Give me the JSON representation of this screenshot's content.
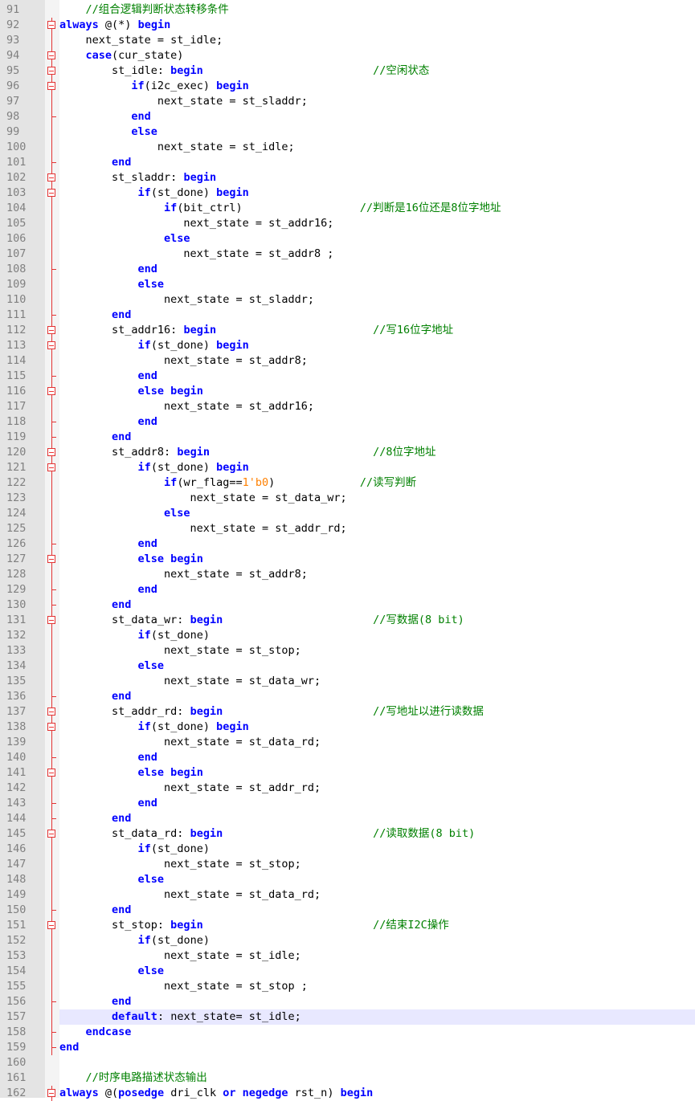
{
  "colors": {
    "keyword": "#0000ff",
    "comment": "#008000",
    "number": "#ff8000",
    "text": "#000000",
    "gutter": "#e4e4e4",
    "fold_marker": "#e33333",
    "current_line": "#e8e8ff"
  },
  "editor": {
    "current_line": 157,
    "lines": [
      {
        "n": "91",
        "fold": "none",
        "t": [
          [
            "c",
            "    //组合逻辑判断状态转移条件"
          ]
        ]
      },
      {
        "n": "92",
        "fold": "box",
        "t": [
          [
            "k",
            "always"
          ],
          [
            "p",
            " @(*) "
          ],
          [
            "k",
            "begin"
          ]
        ]
      },
      {
        "n": "93",
        "fold": "line",
        "t": [
          [
            "p",
            "    next_state = st_idle;"
          ]
        ]
      },
      {
        "n": "94",
        "fold": "box",
        "t": [
          [
            "p",
            "    "
          ],
          [
            "k",
            "case"
          ],
          [
            "p",
            "(cur_state)"
          ]
        ]
      },
      {
        "n": "95",
        "fold": "box",
        "t": [
          [
            "p",
            "        st_idle: "
          ],
          [
            "k",
            "begin"
          ],
          [
            "p",
            "                          "
          ],
          [
            "c",
            "//空闲状态"
          ]
        ]
      },
      {
        "n": "96",
        "fold": "box",
        "t": [
          [
            "p",
            "           "
          ],
          [
            "k",
            "if"
          ],
          [
            "p",
            "(i2c_exec) "
          ],
          [
            "k",
            "begin"
          ]
        ]
      },
      {
        "n": "97",
        "fold": "line",
        "t": [
          [
            "p",
            "               next_state = st_sladdr;"
          ]
        ]
      },
      {
        "n": "98",
        "fold": "tick",
        "t": [
          [
            "p",
            "           "
          ],
          [
            "k",
            "end"
          ]
        ]
      },
      {
        "n": "99",
        "fold": "line",
        "t": [
          [
            "p",
            "           "
          ],
          [
            "k",
            "else"
          ]
        ]
      },
      {
        "n": "100",
        "fold": "line",
        "t": [
          [
            "p",
            "               next_state = st_idle;"
          ]
        ]
      },
      {
        "n": "101",
        "fold": "tick",
        "t": [
          [
            "p",
            "        "
          ],
          [
            "k",
            "end"
          ]
        ]
      },
      {
        "n": "102",
        "fold": "box",
        "t": [
          [
            "p",
            "        st_sladdr: "
          ],
          [
            "k",
            "begin"
          ]
        ]
      },
      {
        "n": "103",
        "fold": "box",
        "t": [
          [
            "p",
            "            "
          ],
          [
            "k",
            "if"
          ],
          [
            "p",
            "(st_done) "
          ],
          [
            "k",
            "begin"
          ]
        ]
      },
      {
        "n": "104",
        "fold": "line",
        "t": [
          [
            "p",
            "                "
          ],
          [
            "k",
            "if"
          ],
          [
            "p",
            "(bit_ctrl)                  "
          ],
          [
            "c",
            "//判断是16位还是8位字地址"
          ]
        ]
      },
      {
        "n": "105",
        "fold": "line",
        "t": [
          [
            "p",
            "                   next_state = st_addr16;"
          ]
        ]
      },
      {
        "n": "106",
        "fold": "line",
        "t": [
          [
            "p",
            "                "
          ],
          [
            "k",
            "else"
          ]
        ]
      },
      {
        "n": "107",
        "fold": "line",
        "t": [
          [
            "p",
            "                   next_state = st_addr8 ;"
          ]
        ]
      },
      {
        "n": "108",
        "fold": "tick",
        "t": [
          [
            "p",
            "            "
          ],
          [
            "k",
            "end"
          ]
        ]
      },
      {
        "n": "109",
        "fold": "line",
        "t": [
          [
            "p",
            "            "
          ],
          [
            "k",
            "else"
          ]
        ]
      },
      {
        "n": "110",
        "fold": "line",
        "t": [
          [
            "p",
            "                next_state = st_sladdr;"
          ]
        ]
      },
      {
        "n": "111",
        "fold": "tick",
        "t": [
          [
            "p",
            "        "
          ],
          [
            "k",
            "end"
          ]
        ]
      },
      {
        "n": "112",
        "fold": "box",
        "t": [
          [
            "p",
            "        st_addr16: "
          ],
          [
            "k",
            "begin"
          ],
          [
            "p",
            "                        "
          ],
          [
            "c",
            "//写16位字地址"
          ]
        ]
      },
      {
        "n": "113",
        "fold": "box",
        "t": [
          [
            "p",
            "            "
          ],
          [
            "k",
            "if"
          ],
          [
            "p",
            "(st_done) "
          ],
          [
            "k",
            "begin"
          ]
        ]
      },
      {
        "n": "114",
        "fold": "line",
        "t": [
          [
            "p",
            "                next_state = st_addr8;"
          ]
        ]
      },
      {
        "n": "115",
        "fold": "tick",
        "t": [
          [
            "p",
            "            "
          ],
          [
            "k",
            "end"
          ]
        ]
      },
      {
        "n": "116",
        "fold": "box",
        "t": [
          [
            "p",
            "            "
          ],
          [
            "k",
            "else begin"
          ]
        ]
      },
      {
        "n": "117",
        "fold": "line",
        "t": [
          [
            "p",
            "                next_state = st_addr16;"
          ]
        ]
      },
      {
        "n": "118",
        "fold": "tick",
        "t": [
          [
            "p",
            "            "
          ],
          [
            "k",
            "end"
          ]
        ]
      },
      {
        "n": "119",
        "fold": "tick",
        "t": [
          [
            "p",
            "        "
          ],
          [
            "k",
            "end"
          ]
        ]
      },
      {
        "n": "120",
        "fold": "box",
        "t": [
          [
            "p",
            "        st_addr8: "
          ],
          [
            "k",
            "begin"
          ],
          [
            "p",
            "                         "
          ],
          [
            "c",
            "//8位字地址"
          ]
        ]
      },
      {
        "n": "121",
        "fold": "box",
        "t": [
          [
            "p",
            "            "
          ],
          [
            "k",
            "if"
          ],
          [
            "p",
            "(st_done) "
          ],
          [
            "k",
            "begin"
          ]
        ]
      },
      {
        "n": "122",
        "fold": "line",
        "t": [
          [
            "p",
            "                "
          ],
          [
            "k",
            "if"
          ],
          [
            "p",
            "(wr_flag=="
          ],
          [
            "n",
            "1'b0"
          ],
          [
            "p",
            ")             "
          ],
          [
            "c",
            "//读写判断"
          ]
        ]
      },
      {
        "n": "123",
        "fold": "line",
        "t": [
          [
            "p",
            "                    next_state = st_data_wr;"
          ]
        ]
      },
      {
        "n": "124",
        "fold": "line",
        "t": [
          [
            "p",
            "                "
          ],
          [
            "k",
            "else"
          ]
        ]
      },
      {
        "n": "125",
        "fold": "line",
        "t": [
          [
            "p",
            "                    next_state = st_addr_rd;"
          ]
        ]
      },
      {
        "n": "126",
        "fold": "tick",
        "t": [
          [
            "p",
            "            "
          ],
          [
            "k",
            "end"
          ]
        ]
      },
      {
        "n": "127",
        "fold": "box",
        "t": [
          [
            "p",
            "            "
          ],
          [
            "k",
            "else begin"
          ]
        ]
      },
      {
        "n": "128",
        "fold": "line",
        "t": [
          [
            "p",
            "                next_state = st_addr8;"
          ]
        ]
      },
      {
        "n": "129",
        "fold": "tick",
        "t": [
          [
            "p",
            "            "
          ],
          [
            "k",
            "end"
          ]
        ]
      },
      {
        "n": "130",
        "fold": "tick",
        "t": [
          [
            "p",
            "        "
          ],
          [
            "k",
            "end"
          ]
        ]
      },
      {
        "n": "131",
        "fold": "box",
        "t": [
          [
            "p",
            "        st_data_wr: "
          ],
          [
            "k",
            "begin"
          ],
          [
            "p",
            "                       "
          ],
          [
            "c",
            "//写数据(8 bit)"
          ]
        ]
      },
      {
        "n": "132",
        "fold": "line",
        "t": [
          [
            "p",
            "            "
          ],
          [
            "k",
            "if"
          ],
          [
            "p",
            "(st_done)"
          ]
        ]
      },
      {
        "n": "133",
        "fold": "line",
        "t": [
          [
            "p",
            "                next_state = st_stop;"
          ]
        ]
      },
      {
        "n": "134",
        "fold": "line",
        "t": [
          [
            "p",
            "            "
          ],
          [
            "k",
            "else"
          ]
        ]
      },
      {
        "n": "135",
        "fold": "line",
        "t": [
          [
            "p",
            "                next_state = st_data_wr;"
          ]
        ]
      },
      {
        "n": "136",
        "fold": "tick",
        "t": [
          [
            "p",
            "        "
          ],
          [
            "k",
            "end"
          ]
        ]
      },
      {
        "n": "137",
        "fold": "box",
        "t": [
          [
            "p",
            "        st_addr_rd: "
          ],
          [
            "k",
            "begin"
          ],
          [
            "p",
            "                       "
          ],
          [
            "c",
            "//写地址以进行读数据"
          ]
        ]
      },
      {
        "n": "138",
        "fold": "box",
        "t": [
          [
            "p",
            "            "
          ],
          [
            "k",
            "if"
          ],
          [
            "p",
            "(st_done) "
          ],
          [
            "k",
            "begin"
          ]
        ]
      },
      {
        "n": "139",
        "fold": "line",
        "t": [
          [
            "p",
            "                next_state = st_data_rd;"
          ]
        ]
      },
      {
        "n": "140",
        "fold": "tick",
        "t": [
          [
            "p",
            "            "
          ],
          [
            "k",
            "end"
          ]
        ]
      },
      {
        "n": "141",
        "fold": "box",
        "t": [
          [
            "p",
            "            "
          ],
          [
            "k",
            "else begin"
          ]
        ]
      },
      {
        "n": "142",
        "fold": "line",
        "t": [
          [
            "p",
            "                next_state = st_addr_rd;"
          ]
        ]
      },
      {
        "n": "143",
        "fold": "tick",
        "t": [
          [
            "p",
            "            "
          ],
          [
            "k",
            "end"
          ]
        ]
      },
      {
        "n": "144",
        "fold": "tick",
        "t": [
          [
            "p",
            "        "
          ],
          [
            "k",
            "end"
          ]
        ]
      },
      {
        "n": "145",
        "fold": "box",
        "t": [
          [
            "p",
            "        st_data_rd: "
          ],
          [
            "k",
            "begin"
          ],
          [
            "p",
            "                       "
          ],
          [
            "c",
            "//读取数据(8 bit)"
          ]
        ]
      },
      {
        "n": "146",
        "fold": "line",
        "t": [
          [
            "p",
            "            "
          ],
          [
            "k",
            "if"
          ],
          [
            "p",
            "(st_done)"
          ]
        ]
      },
      {
        "n": "147",
        "fold": "line",
        "t": [
          [
            "p",
            "                next_state = st_stop;"
          ]
        ]
      },
      {
        "n": "148",
        "fold": "line",
        "t": [
          [
            "p",
            "            "
          ],
          [
            "k",
            "else"
          ]
        ]
      },
      {
        "n": "149",
        "fold": "line",
        "t": [
          [
            "p",
            "                next_state = st_data_rd;"
          ]
        ]
      },
      {
        "n": "150",
        "fold": "tick",
        "t": [
          [
            "p",
            "        "
          ],
          [
            "k",
            "end"
          ]
        ]
      },
      {
        "n": "151",
        "fold": "box",
        "t": [
          [
            "p",
            "        st_stop: "
          ],
          [
            "k",
            "begin"
          ],
          [
            "p",
            "                          "
          ],
          [
            "c",
            "//结束I2C操作"
          ]
        ]
      },
      {
        "n": "152",
        "fold": "line",
        "t": [
          [
            "p",
            "            "
          ],
          [
            "k",
            "if"
          ],
          [
            "p",
            "(st_done)"
          ]
        ]
      },
      {
        "n": "153",
        "fold": "line",
        "t": [
          [
            "p",
            "                next_state = st_idle;"
          ]
        ]
      },
      {
        "n": "154",
        "fold": "line",
        "t": [
          [
            "p",
            "            "
          ],
          [
            "k",
            "else"
          ]
        ]
      },
      {
        "n": "155",
        "fold": "line",
        "t": [
          [
            "p",
            "                next_state = st_stop ;"
          ]
        ]
      },
      {
        "n": "156",
        "fold": "tick",
        "t": [
          [
            "p",
            "        "
          ],
          [
            "k",
            "end"
          ]
        ]
      },
      {
        "n": "157",
        "fold": "line",
        "t": [
          [
            "p",
            "        "
          ],
          [
            "k",
            "default"
          ],
          [
            "p",
            ": next_state= st_idle;"
          ]
        ]
      },
      {
        "n": "158",
        "fold": "tick",
        "t": [
          [
            "p",
            "    "
          ],
          [
            "k",
            "endcase"
          ]
        ]
      },
      {
        "n": "159",
        "fold": "tick",
        "t": [
          [
            "k",
            "end"
          ]
        ]
      },
      {
        "n": "160",
        "fold": "none",
        "t": []
      },
      {
        "n": "161",
        "fold": "none",
        "t": [
          [
            "c",
            "    //时序电路描述状态输出"
          ]
        ]
      },
      {
        "n": "162",
        "fold": "box",
        "t": [
          [
            "k",
            "always"
          ],
          [
            "p",
            " @("
          ],
          [
            "k",
            "posedge"
          ],
          [
            "p",
            " dri_clk "
          ],
          [
            "k",
            "or"
          ],
          [
            "p",
            " "
          ],
          [
            "k",
            "negedge"
          ],
          [
            "p",
            " rst_n) "
          ],
          [
            "k",
            "begin"
          ]
        ]
      }
    ]
  }
}
